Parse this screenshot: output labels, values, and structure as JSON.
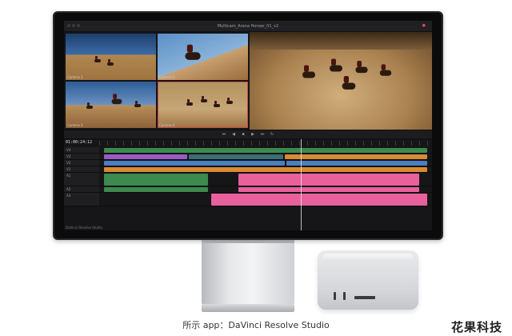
{
  "app": {
    "title": "Multicam_Arena Horses_01_v2",
    "timecode": "01:00:24:12",
    "footer": "DaVinci Resolve Studio"
  },
  "viewer": {
    "angles": [
      "Camera 1",
      "Camera 2",
      "Camera 3",
      "Camera 4"
    ]
  },
  "timeline": {
    "tracks": [
      {
        "id": "V4",
        "label": "V4"
      },
      {
        "id": "V3",
        "label": "V3"
      },
      {
        "id": "V2",
        "label": "V2"
      },
      {
        "id": "V1",
        "label": "V1"
      },
      {
        "id": "A1",
        "label": "A1"
      },
      {
        "id": "A2",
        "label": "A2"
      },
      {
        "id": "A3",
        "label": "A3"
      },
      {
        "id": "A4",
        "label": "A4"
      },
      {
        "id": "A5",
        "label": "A5"
      }
    ]
  },
  "caption": "所示 app：DaVinci Resolve Studio",
  "watermark": "花果科技",
  "colors": {
    "clip_green": "#3d8a4f",
    "clip_purple": "#9b59c4",
    "clip_orange": "#d98a33",
    "clip_blue": "#4a7fc2",
    "clip_pink": "#e8609c"
  }
}
